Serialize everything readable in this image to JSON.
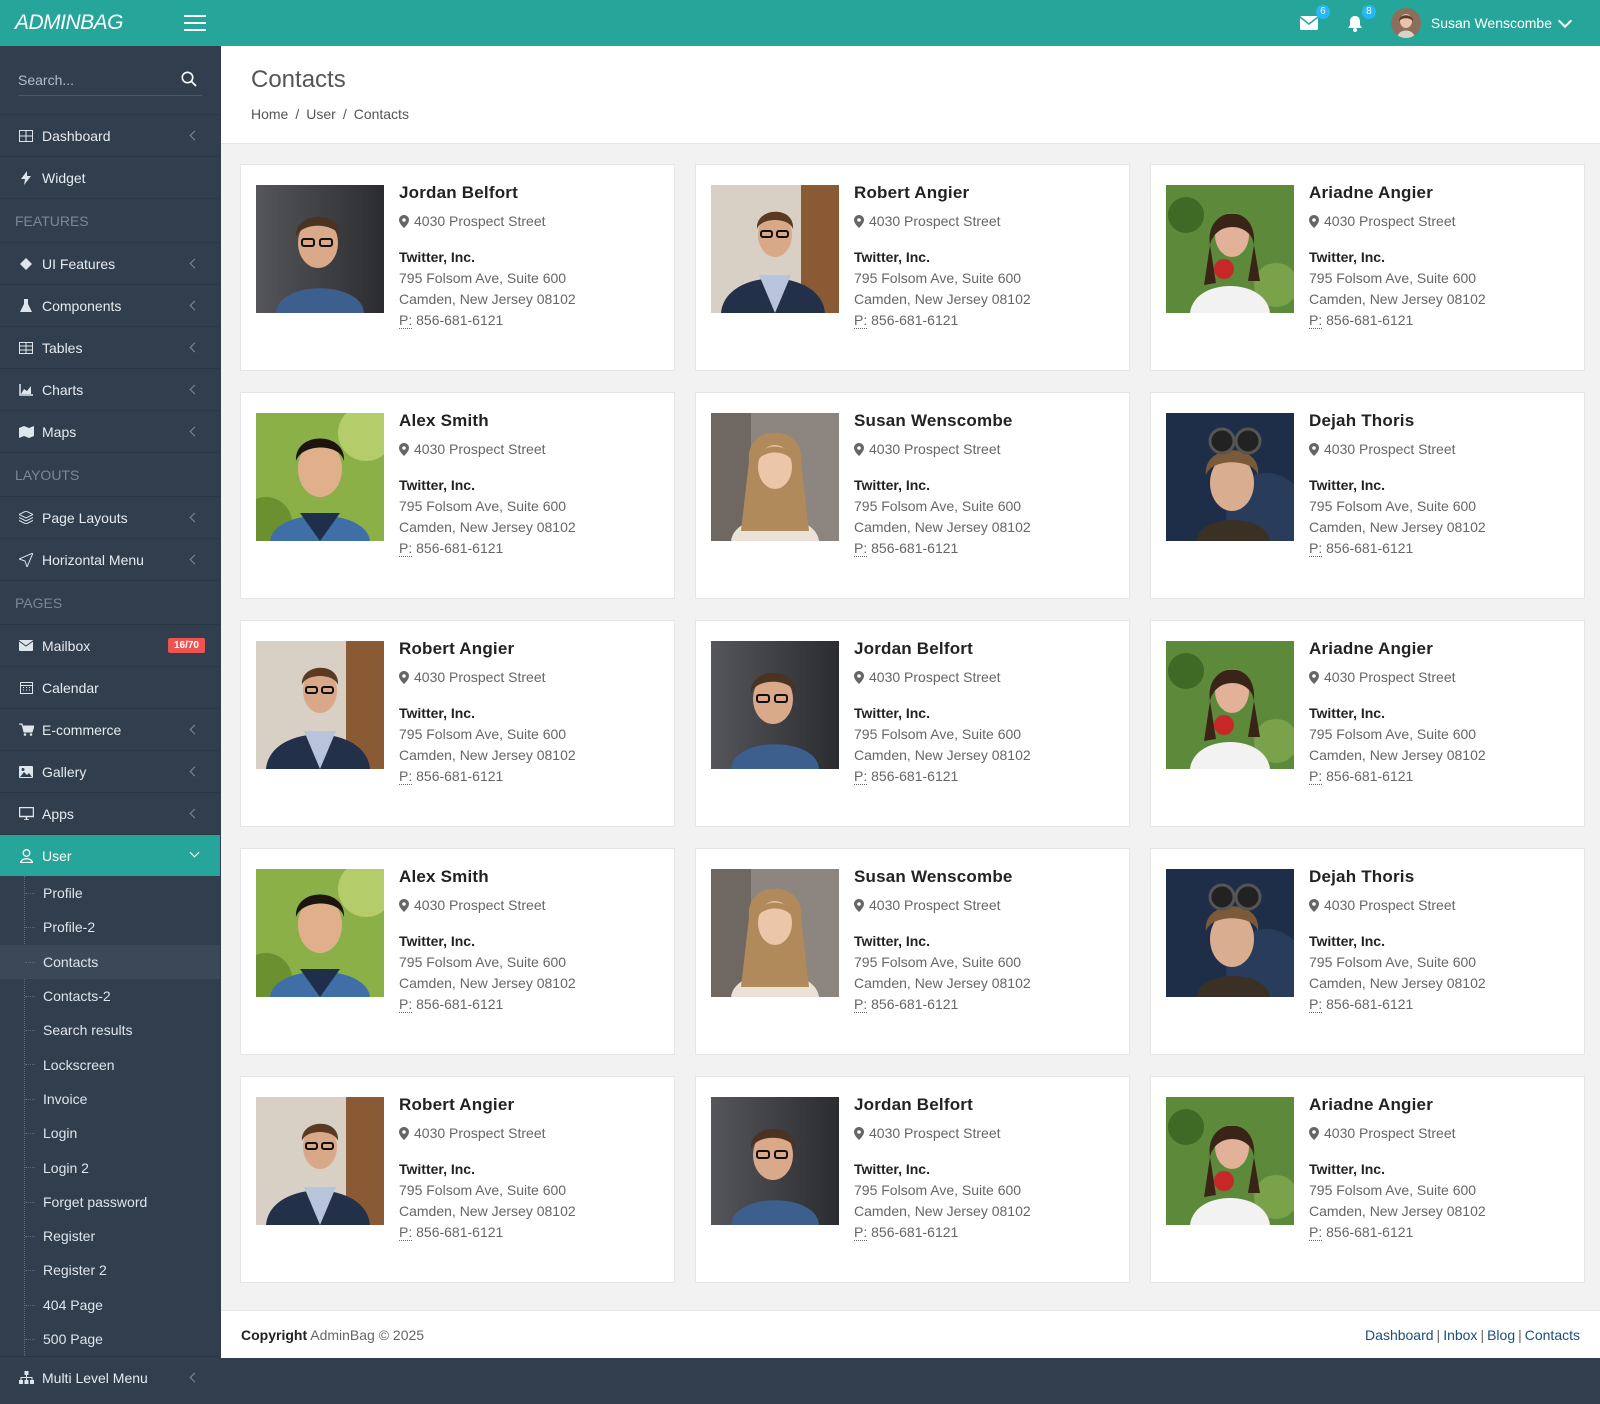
{
  "brand": {
    "logo": "ADMINBAG"
  },
  "header": {
    "mail_count": "6",
    "notif_count": "8",
    "user_name": "Susan Wenscombe"
  },
  "sidebar": {
    "search_placeholder": "Search...",
    "items_top": [
      {
        "label": "Dashboard",
        "icon": "grid-icon"
      },
      {
        "label": "Widget",
        "icon": "bolt-icon"
      }
    ],
    "section_features": "FEATURES",
    "items_features": [
      {
        "label": "UI Features",
        "icon": "diamond-icon"
      },
      {
        "label": "Components",
        "icon": "flask-icon"
      },
      {
        "label": "Tables",
        "icon": "table-icon"
      },
      {
        "label": "Charts",
        "icon": "area-chart-icon"
      },
      {
        "label": "Maps",
        "icon": "map-icon"
      }
    ],
    "section_layouts": "LAYOUTS",
    "items_layouts": [
      {
        "label": "Page Layouts",
        "icon": "layers-icon"
      },
      {
        "label": "Horizontal Menu",
        "icon": "send-icon"
      }
    ],
    "section_pages": "PAGES",
    "mailbox": {
      "label": "Mailbox",
      "badge": "16/70"
    },
    "items_pages": [
      {
        "label": "Calendar",
        "icon": "calendar-icon"
      },
      {
        "label": "E-commerce",
        "icon": "cart-icon"
      },
      {
        "label": "Gallery",
        "icon": "image-icon"
      },
      {
        "label": "Apps",
        "icon": "monitor-icon"
      }
    ],
    "user": {
      "label": "User"
    },
    "user_sub": [
      "Profile",
      "Profile-2",
      "Contacts",
      "Contacts-2",
      "Search results",
      "Lockscreen",
      "Invoice",
      "Login",
      "Login 2",
      "Forget password",
      "Register",
      "Register 2",
      "404 Page",
      "500 Page"
    ],
    "multi_level": "Multi Level Menu"
  },
  "page": {
    "title": "Contacts",
    "breadcrumb": [
      "Home",
      "User",
      "Contacts"
    ]
  },
  "contacts": [
    {
      "name": "Jordan Belfort",
      "photo": "man-glasses-dark"
    },
    {
      "name": "Robert Angier",
      "photo": "man-glasses-jacket"
    },
    {
      "name": "Ariadne Angier",
      "photo": "woman-apple"
    },
    {
      "name": "Alex Smith",
      "photo": "man-green-bg"
    },
    {
      "name": "Susan Wenscombe",
      "photo": "woman-blonde"
    },
    {
      "name": "Dejah Thoris",
      "photo": "woman-goggles"
    },
    {
      "name": "Robert Angier",
      "photo": "man-glasses-jacket"
    },
    {
      "name": "Jordan Belfort",
      "photo": "man-glasses-dark"
    },
    {
      "name": "Ariadne Angier",
      "photo": "woman-apple"
    },
    {
      "name": "Alex Smith",
      "photo": "man-green-bg"
    },
    {
      "name": "Susan Wenscombe",
      "photo": "woman-blonde"
    },
    {
      "name": "Dejah Thoris",
      "photo": "woman-goggles"
    },
    {
      "name": "Robert Angier",
      "photo": "man-glasses-jacket"
    },
    {
      "name": "Jordan Belfort",
      "photo": "man-glasses-dark"
    },
    {
      "name": "Ariadne Angier",
      "photo": "woman-apple"
    }
  ],
  "contact_common": {
    "address": "4030 Prospect Street",
    "company": "Twitter, Inc.",
    "street": "795 Folsom Ave, Suite 600",
    "city": "Camden, New Jersey 08102",
    "phone_label": "P:",
    "phone": "856-681-6121"
  },
  "footer": {
    "copyright_bold": "Copyright",
    "copyright_text": "AdminBag © 2025",
    "links": [
      "Dashboard",
      "Inbox",
      "Blog",
      "Contacts"
    ]
  },
  "colors": {
    "accent": "#26a69a",
    "sidebar": "#313e4e",
    "badge_blue": "#29b6f6",
    "badge_red": "#ef5350"
  }
}
